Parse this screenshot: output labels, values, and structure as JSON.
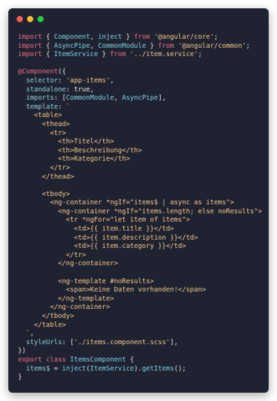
{
  "window": {
    "controls": [
      "close",
      "minimize",
      "maximize"
    ]
  },
  "code": {
    "lines": [
      [
        [
          "kw",
          "import"
        ],
        [
          "pl",
          " { "
        ],
        [
          "cls",
          "Component"
        ],
        [
          "pl",
          ", "
        ],
        [
          "cls",
          "inject"
        ],
        [
          "pl",
          " } "
        ],
        [
          "kw",
          "from"
        ],
        [
          "pl",
          " "
        ],
        [
          "str",
          "'@angular/core'"
        ],
        [
          "pl",
          ";"
        ]
      ],
      [
        [
          "kw",
          "import"
        ],
        [
          "pl",
          " { "
        ],
        [
          "cls",
          "AsyncPipe"
        ],
        [
          "pl",
          ", "
        ],
        [
          "cls",
          "CommonModule"
        ],
        [
          "pl",
          " } "
        ],
        [
          "kw",
          "from"
        ],
        [
          "pl",
          " "
        ],
        [
          "str",
          "'@angular/common'"
        ],
        [
          "pl",
          ";"
        ]
      ],
      [
        [
          "kw",
          "import"
        ],
        [
          "pl",
          " { "
        ],
        [
          "cls",
          "ItemService"
        ],
        [
          "pl",
          " } "
        ],
        [
          "kw",
          "from"
        ],
        [
          "pl",
          " "
        ],
        [
          "str",
          "'../item.service'"
        ],
        [
          "pl",
          ";"
        ]
      ],
      [],
      [
        [
          "dec",
          "@Component"
        ],
        [
          "pl",
          "({"
        ]
      ],
      [
        [
          "pl",
          "  "
        ],
        [
          "prop",
          "selector"
        ],
        [
          "pl",
          ": "
        ],
        [
          "str",
          "'app-items'"
        ],
        [
          "pl",
          ","
        ]
      ],
      [
        [
          "pl",
          "  "
        ],
        [
          "prop",
          "standalone"
        ],
        [
          "pl",
          ": true,"
        ]
      ],
      [
        [
          "pl",
          "  "
        ],
        [
          "prop",
          "imports"
        ],
        [
          "pl",
          ": ["
        ],
        [
          "cls",
          "CommonModule"
        ],
        [
          "pl",
          ", "
        ],
        [
          "cls",
          "AsyncPipe"
        ],
        [
          "pl",
          "],"
        ]
      ],
      [
        [
          "pl",
          "  "
        ],
        [
          "prop",
          "template"
        ],
        [
          "pl",
          ": "
        ],
        [
          "str",
          "`"
        ]
      ],
      [
        [
          "str",
          "    <table>"
        ]
      ],
      [
        [
          "str",
          "      <thead>"
        ]
      ],
      [
        [
          "str",
          "        <tr>"
        ]
      ],
      [
        [
          "str",
          "          <th>Titel</th>"
        ]
      ],
      [
        [
          "str",
          "          <th>Beschreibung</th>"
        ]
      ],
      [
        [
          "str",
          "          <th>Kategorie</th>"
        ]
      ],
      [
        [
          "str",
          "        </tr>"
        ]
      ],
      [
        [
          "str",
          "      </thead>"
        ]
      ],
      [],
      [
        [
          "str",
          "      <tbody>"
        ]
      ],
      [
        [
          "str",
          "        <ng-container *ngIf=\"items$ | async as items\">"
        ]
      ],
      [
        [
          "str",
          "          <ng-container *ngIf=\"items.length; else noResults\">"
        ]
      ],
      [
        [
          "str",
          "            <tr *ngFor=\"let item of items\">"
        ]
      ],
      [
        [
          "str",
          "              <td>{{ item.title }}</td>"
        ]
      ],
      [
        [
          "str",
          "              <td>{{ item.description }}</td>"
        ]
      ],
      [
        [
          "str",
          "              <td>{{ item.category }}</td>"
        ]
      ],
      [
        [
          "str",
          "            </tr>"
        ]
      ],
      [
        [
          "str",
          "          </ng-container>"
        ]
      ],
      [],
      [
        [
          "str",
          "          <ng-template #noResults>"
        ]
      ],
      [
        [
          "str",
          "            <span>Keine Daten vorhanden!</span>"
        ]
      ],
      [
        [
          "str",
          "          </ng-template>"
        ]
      ],
      [
        [
          "str",
          "        </ng-container>"
        ]
      ],
      [
        [
          "str",
          "      </tbody>"
        ]
      ],
      [
        [
          "str",
          "    </table>"
        ]
      ],
      [
        [
          "str",
          "  `"
        ],
        [
          "pl",
          ","
        ]
      ],
      [
        [
          "pl",
          "  "
        ],
        [
          "prop",
          "styleUrls"
        ],
        [
          "pl",
          ": ["
        ],
        [
          "str",
          "'./items.component.scss'"
        ],
        [
          "pl",
          "],"
        ]
      ],
      [
        [
          "pl",
          "})"
        ]
      ],
      [
        [
          "kw",
          "export"
        ],
        [
          "pl",
          " "
        ],
        [
          "kw",
          "class"
        ],
        [
          "pl",
          " "
        ],
        [
          "cls",
          "ItemsComponent"
        ],
        [
          "pl",
          " {"
        ]
      ],
      [
        [
          "pl",
          "  "
        ],
        [
          "prop",
          "items$"
        ],
        [
          "pl",
          " = "
        ],
        [
          "fn",
          "inject"
        ],
        [
          "pl",
          "("
        ],
        [
          "cls",
          "ItemService"
        ],
        [
          "pl",
          ")."
        ],
        [
          "fn",
          "getItems"
        ],
        [
          "pl",
          "();"
        ]
      ],
      [
        [
          "pl",
          "}"
        ]
      ]
    ]
  }
}
